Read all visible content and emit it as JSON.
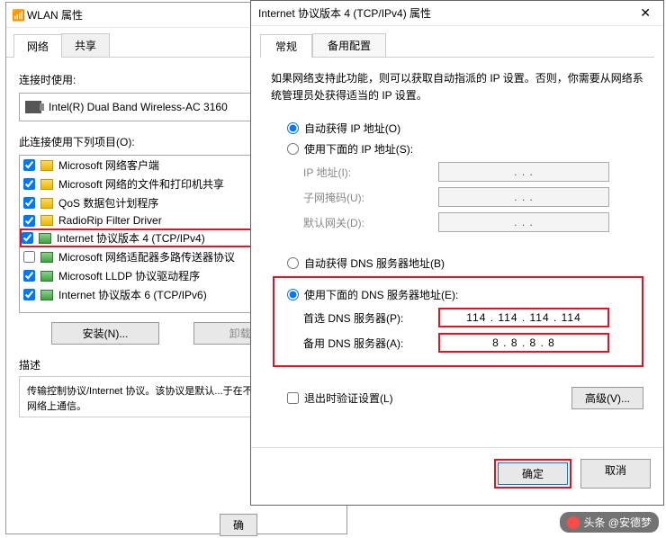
{
  "win1": {
    "title": "WLAN 属性",
    "tabs": [
      "网络",
      "共享"
    ],
    "connect_label": "连接时使用:",
    "adapter": "Intel(R) Dual Band Wireless-AC 3160",
    "items_label": "此连接使用下列项目(O):",
    "items": [
      {
        "label": "Microsoft 网络客户端",
        "checked": true,
        "icon": "y"
      },
      {
        "label": "Microsoft 网络的文件和打印机共享",
        "checked": true,
        "icon": "y"
      },
      {
        "label": "QoS 数据包计划程序",
        "checked": true,
        "icon": "y"
      },
      {
        "label": "RadioRip Filter Driver",
        "checked": true,
        "icon": "y"
      },
      {
        "label": "Internet 协议版本 4 (TCP/IPv4)",
        "checked": true,
        "icon": "g",
        "hl": true
      },
      {
        "label": "Microsoft 网络适配器多路传送器协议",
        "checked": false,
        "icon": "g"
      },
      {
        "label": "Microsoft LLDP 协议驱动程序",
        "checked": true,
        "icon": "g"
      },
      {
        "label": "Internet 协议版本 6 (TCP/IPv6)",
        "checked": true,
        "icon": "g"
      }
    ],
    "install_btn": "安装(N)...",
    "uninstall_btn": "卸载(U)",
    "desc_label": "描述",
    "desc_text": "传输控制协议/Internet 协议。该协议是默认...于在不同的相互连接的网络上通信。",
    "bottom_btn": "确"
  },
  "win2": {
    "title": "Internet 协议版本 4 (TCP/IPv4) 属性",
    "tabs": [
      "常规",
      "备用配置"
    ],
    "intro": "如果网络支持此功能，则可以获取自动指派的 IP 设置。否则，你需要从网络系统管理员处获得适当的 IP 设置。",
    "ip_auto": "自动获得 IP 地址(O)",
    "ip_manual": "使用下面的 IP 地址(S):",
    "ip_label": "IP 地址(I):",
    "mask_label": "子网掩码(U):",
    "gw_label": "默认网关(D):",
    "dns_auto": "自动获得 DNS 服务器地址(B)",
    "dns_manual": "使用下面的 DNS 服务器地址(E):",
    "dns1_label": "首选 DNS 服务器(P):",
    "dns2_label": "备用 DNS 服务器(A):",
    "dns1_value": "114 . 114 . 114 . 114",
    "dns2_value": "8  .  8  .  8  .  8",
    "validate": "退出时验证设置(L)",
    "advanced": "高级(V)...",
    "ok": "确定",
    "cancel": "取消",
    "dot_placeholder": ".        .        ."
  },
  "watermark": "头条 @安德梦"
}
